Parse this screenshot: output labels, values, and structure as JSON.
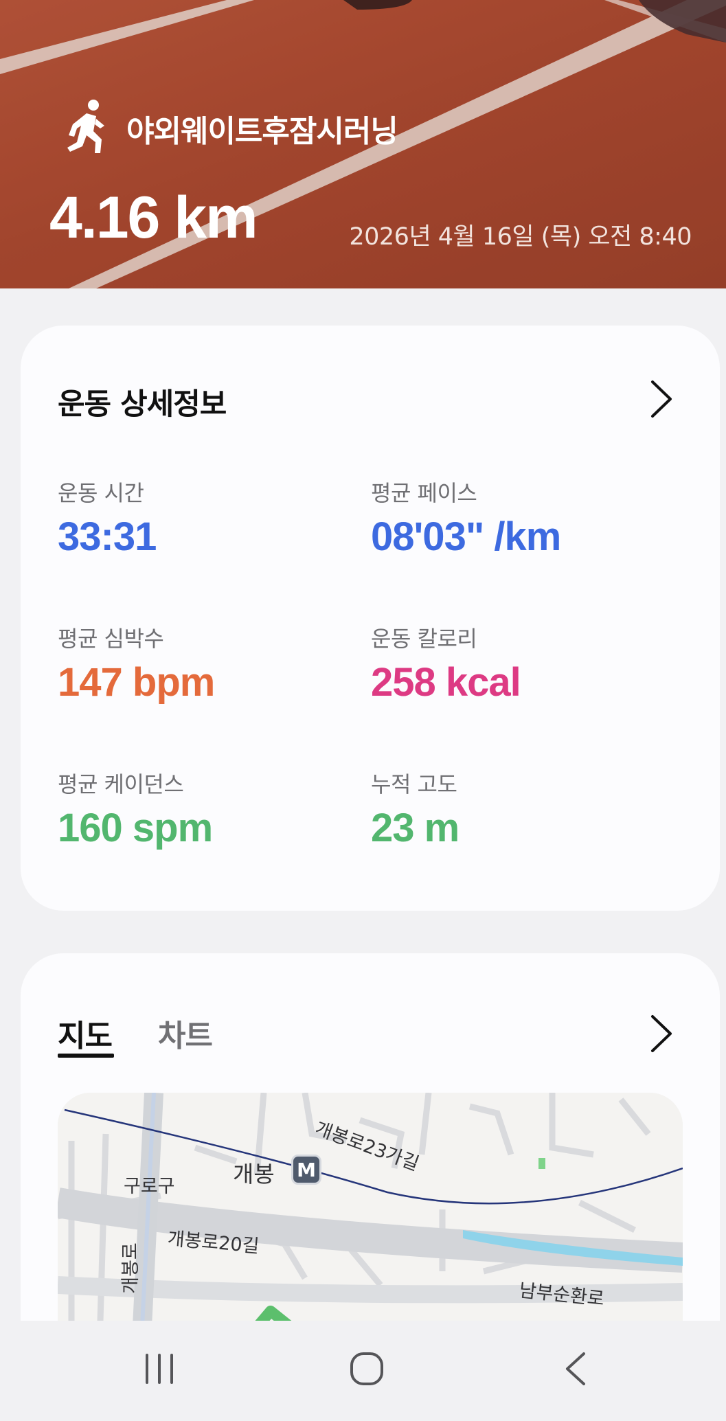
{
  "hero": {
    "workout_name": "야외웨이트후잠시러닝",
    "distance": "4.16 km",
    "datetime": "2026년 4월 16일 (목) 오전 8:40",
    "icon": "running-person-icon"
  },
  "details": {
    "title": "운동 상세정보",
    "stats": [
      {
        "label": "운동 시간",
        "value": "33:31",
        "color": "#3d6ae0"
      },
      {
        "label": "평균 페이스",
        "value": "08'03\" /km",
        "color": "#3d6ae0"
      },
      {
        "label": "평균 심박수",
        "value": "147 bpm",
        "color": "#e46a3b"
      },
      {
        "label": "운동 칼로리",
        "value": "258 kcal",
        "color": "#dd3a83"
      },
      {
        "label": "평균 케이던스",
        "value": "160 spm",
        "color": "#52b66e"
      },
      {
        "label": "누적 고도",
        "value": "23 m",
        "color": "#52b66e"
      }
    ]
  },
  "map_card": {
    "tabs": [
      {
        "label": "지도",
        "active": true
      },
      {
        "label": "차트",
        "active": false
      }
    ],
    "map_labels": {
      "road_23": "개봉로23가길",
      "station": "개봉",
      "district": "구로구",
      "road_20": "개봉로20길",
      "road_main": "개봉로",
      "ring_road": "남부순환로",
      "metro_badge": "M"
    },
    "route_color": "#5cbf6c"
  },
  "navbar": {
    "buttons": [
      "recent-apps",
      "home",
      "back"
    ]
  }
}
